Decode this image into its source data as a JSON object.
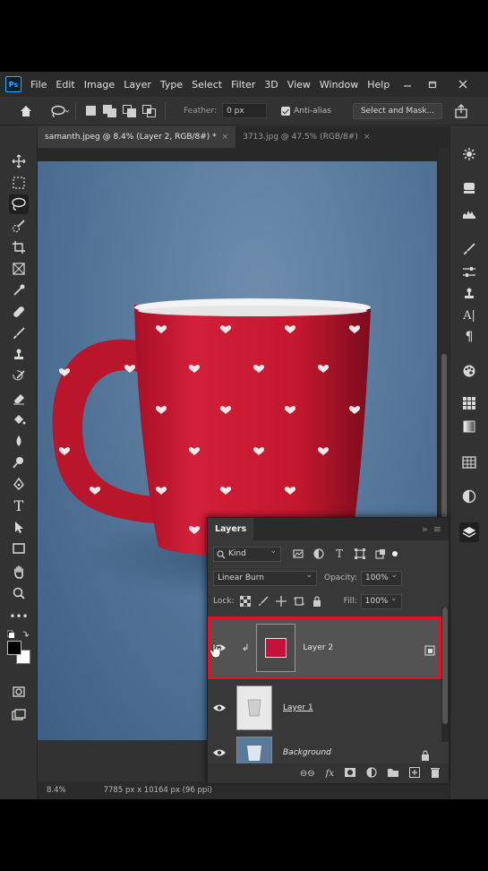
{
  "app": {
    "logo": "Ps"
  },
  "menu": [
    "File",
    "Edit",
    "Image",
    "Layer",
    "Type",
    "Select",
    "Filter",
    "3D",
    "View",
    "Window",
    "Help"
  ],
  "window_controls": [
    "minimize-icon",
    "restore-icon",
    "close-icon"
  ],
  "options_bar": {
    "feather_label": "Feather:",
    "feather_value": "0 px",
    "antialias_label": "Anti-alias",
    "select_mask_label": "Select and Mask..."
  },
  "tabs": [
    {
      "label": "samanth.jpeg @ 8.4% (Layer 2, RGB/8#) *",
      "close": "×",
      "active": true
    },
    {
      "label": "3713.jpg @ 47.5% (RGB/8#)",
      "close": "×",
      "active": false
    }
  ],
  "status": {
    "zoom": "8.4%",
    "doc_info": "7785 px x 10164 px (96 ppi)"
  },
  "layers_panel": {
    "title": "Layers",
    "menu_glyph": "≡",
    "collapse_glyph": "»",
    "filter_kind": "Kind",
    "blend_mode": "Linear Burn",
    "opacity_label": "Opacity:",
    "opacity_value": "100%",
    "lock_label": "Lock:",
    "fill_label": "Fill:",
    "fill_value": "100%",
    "layers": [
      {
        "name": "Layer 2",
        "selected": true,
        "clipped": true
      },
      {
        "name": "Layer 1",
        "selected": false,
        "clipped": false
      },
      {
        "name": "Background",
        "selected": false,
        "locked": true
      }
    ]
  },
  "colors": {
    "accent_highlight": "#e0151f",
    "mug_red": "#c3172e",
    "backdrop_blue": "#5b7ea1",
    "ui_dark": "#323232"
  }
}
